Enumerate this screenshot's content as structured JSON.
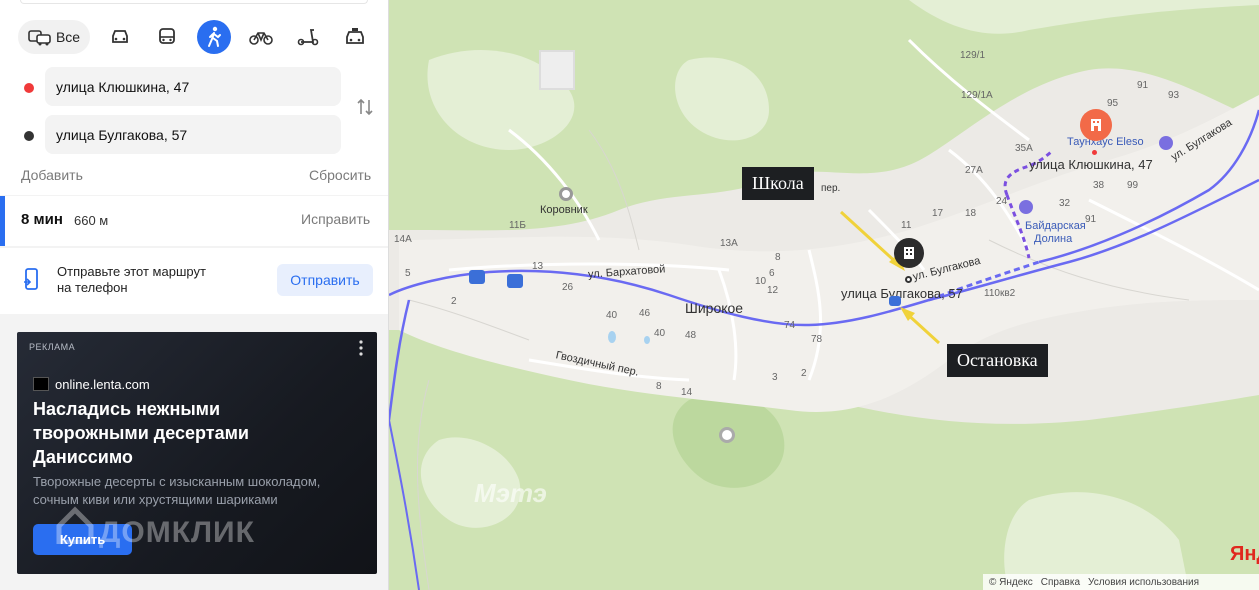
{
  "modes": {
    "all_label": "Все",
    "items": [
      "car-icon",
      "bus-icon",
      "pedestrian-icon",
      "bike-icon",
      "scooter-icon",
      "taxi-icon"
    ],
    "active": "pedestrian-icon"
  },
  "route": {
    "from": "улица Клюшкина, 47",
    "to": "улица Булгакова, 57",
    "add_label": "Добавить",
    "reset_label": "Сбросить",
    "time": "8 мин",
    "distance": "660 м",
    "fix_label": "Исправить"
  },
  "send": {
    "text_line1": "Отправьте этот маршрут",
    "text_line2": "на телефон",
    "button_label": "Отправить"
  },
  "ad": {
    "tag": "РЕКЛАМА",
    "domain": "online.lenta.com",
    "headline_l1": "Насладись нежными",
    "headline_l2": "творожными десертами",
    "headline_l3": "Даниссимо",
    "body_l1": "Творожные десерты с изысканным шоколадом,",
    "body_l2": "сочным киви или хрустящими шариками",
    "button_label": "Купить",
    "watermark": "ДОМКЛИК"
  },
  "map": {
    "callout_school": "Школа",
    "callout_stop": "Остановка",
    "addr_from": "улица Клюшкина, 47",
    "addr_to": "улица Булгакова, 57",
    "village": "Широкое",
    "place_korovnik": "Коровник",
    "street_barkhatovoy": "ул. Бархатовой",
    "street_gvozdichny": "Гвоздичный пер.",
    "street_bulgakova": "ул. Булгакова",
    "street_bulgakova2": "ул. Булгакова",
    "street_per": "пер.",
    "poi_townhouse": "Таунхаус Eleso",
    "poi_baidar_l1": "Байдарская",
    "poi_baidar_l2": "Долина",
    "watermark": "Мэтэ",
    "logo": "Янд",
    "footer_copy": "© Яндекс",
    "footer_help": "Справка",
    "footer_terms": "Условия использования",
    "house_numbers": [
      "129/1",
      "129/1А",
      "91",
      "93",
      "95",
      "35А",
      "38",
      "99",
      "27А",
      "24",
      "32",
      "91",
      "17",
      "18",
      "11",
      "13А",
      "13",
      "11Б",
      "14А",
      "5",
      "2",
      "26",
      "40",
      "46",
      "40",
      "48",
      "74",
      "78",
      "3",
      "2",
      "8",
      "14",
      "110кв2",
      "12",
      "8",
      "6",
      "10"
    ]
  },
  "colors": {
    "accent": "#2a6ef0",
    "route_line": "#5b5ff0",
    "from_dot": "#f03a3a",
    "to_dot": "#333333",
    "callout_arrow": "#f0d23a",
    "poi": "#f26a48"
  }
}
